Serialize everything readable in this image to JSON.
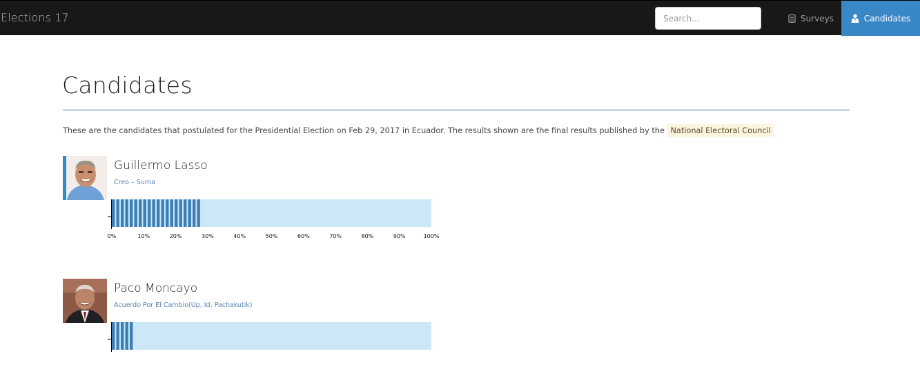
{
  "navbar": {
    "brand": "Elections 17",
    "search_placeholder": "Search...",
    "items": [
      {
        "label": "Surveys",
        "icon": "document-icon",
        "active": false
      },
      {
        "label": "Candidates",
        "icon": "person-icon",
        "active": true
      }
    ],
    "active_color": "#3a87c8"
  },
  "page": {
    "title": "Candidates",
    "intro_text": "These are the candidates that postulated for the Presidential Election on Feb 29, 2017 in Ecuador. The results shown are the final results published by the",
    "intro_link": "National Electoral Council"
  },
  "candidates": [
    {
      "name": "Guillermo Lasso",
      "party": "Creo – Suma",
      "photo_bg": "#f2ede8",
      "vote_percent": 28.1
    },
    {
      "name": "Paco Moncayo",
      "party": "Acuerdo Por El Cambio(Up, Id, Pachakutik)",
      "photo_bg": "#7a4b3a",
      "vote_percent": 6.7
    }
  ],
  "chart_data": [
    {
      "type": "bar",
      "categories": [
        "Guillermo Lasso"
      ],
      "values": [
        28.1
      ],
      "xlim": [
        0,
        100
      ],
      "tick_labels": [
        "0%",
        "10%",
        "20%",
        "30%",
        "40%",
        "50%",
        "60%",
        "70%",
        "80%",
        "90%",
        "100%"
      ],
      "bar_color": "#3d7fb5",
      "track_color": "#cce8f7"
    },
    {
      "type": "bar",
      "categories": [
        "Paco Moncayo"
      ],
      "values": [
        6.7
      ],
      "xlim": [
        0,
        100
      ],
      "bar_color": "#3d7fb5",
      "track_color": "#cce8f7"
    }
  ]
}
